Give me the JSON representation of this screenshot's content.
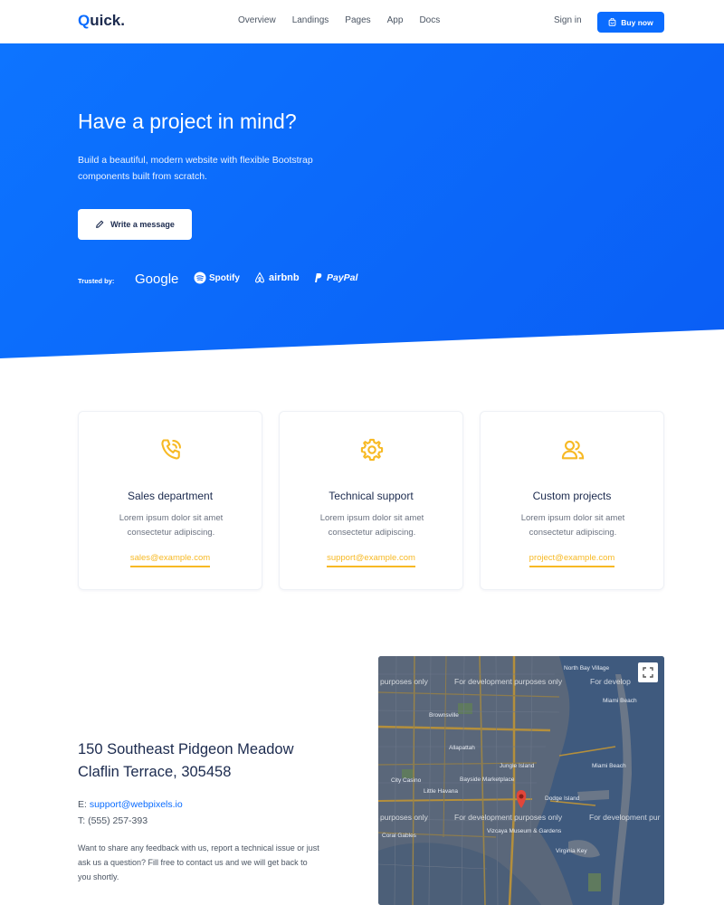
{
  "nav": {
    "logo": "uick.",
    "logo_initial": "Q",
    "links": [
      "Overview",
      "Landings",
      "Pages",
      "App",
      "Docs"
    ],
    "sign_in": "Sign in",
    "buy_now": "Buy now"
  },
  "hero": {
    "title": "Have a project in mind?",
    "subtitle": "Build a beautiful, modern website with flexible Bootstrap components built from scratch.",
    "cta": "Write a message",
    "trusted_label": "Trusted by:",
    "brands": [
      "Google",
      "Spotify",
      "airbnb",
      "PayPal"
    ]
  },
  "cards": [
    {
      "title": "Sales department",
      "desc": "Lorem ipsum dolor sit amet consectetur adipiscing.",
      "email": "sales@example.com",
      "icon": "phone-call-icon"
    },
    {
      "title": "Technical support",
      "desc": "Lorem ipsum dolor sit amet consectetur adipiscing.",
      "email": "support@example.com",
      "icon": "gear-icon"
    },
    {
      "title": "Custom projects",
      "desc": "Lorem ipsum dolor sit amet consectetur adipiscing.",
      "email": "project@example.com",
      "icon": "users-icon"
    }
  ],
  "contact": {
    "address_line1": "150 Southeast Pidgeon Meadow",
    "address_line2": "Claflin Terrace, 305458",
    "email_prefix": "E: ",
    "email": "support@webpixels.io",
    "phone": "T: (555) 257-393",
    "feedback": "Want to share any feedback with us, report a technical issue or just ask us a question? Fill free to contact us and we will get back to you shortly."
  },
  "map": {
    "dev_notice": "For development purposes only",
    "dev_notice_partial_left": "purposes only",
    "dev_notice_partial_right": "For development pur",
    "dev_notice_partial_top_right": "For develop",
    "labels": [
      "North Bay Village",
      "Brownsville",
      "Miami Beach",
      "Allapattah",
      "Jungle Island",
      "City Casino",
      "Bayside Marketplace",
      "Dodge Island",
      "Miami Beach",
      "Coral Gables",
      "Vizcaya Museum & Gardens",
      "Virginia Key",
      "Little Havana"
    ]
  },
  "colors": {
    "primary": "#0a6cff",
    "accent": "#f7b924",
    "heading": "#1b2a4e"
  }
}
